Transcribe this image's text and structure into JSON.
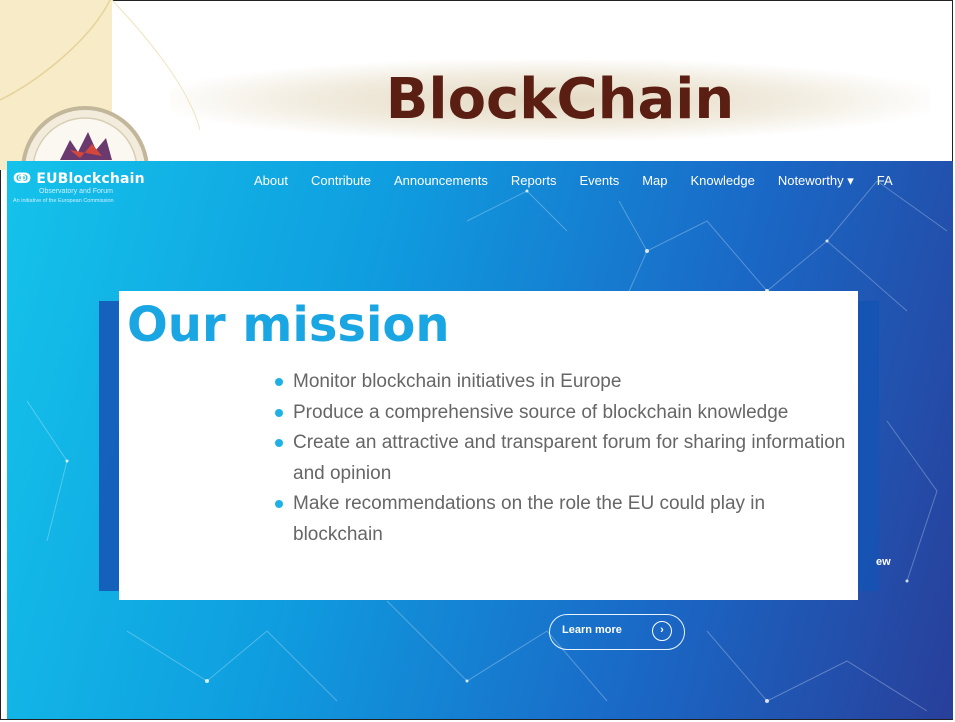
{
  "slide": {
    "title": "BlockChain"
  },
  "site": {
    "logo_text": "EUBlockchain",
    "logo_subtitle": "Observatory and Forum",
    "logo_tagline": "An initiative of the European Commission",
    "nav": [
      "About",
      "Contribute",
      "Announcements",
      "Reports",
      "Events",
      "Map",
      "Knowledge",
      "Noteworthy ▾",
      "FA"
    ],
    "partial_text": "ew",
    "learn_more": "Learn more",
    "learn_more_icon": "chevron-right-icon"
  },
  "mission": {
    "title": "Our mission",
    "items": [
      "Monitor blockchain initiatives in Europe",
      "Produce a comprehensive source of blockchain knowledge",
      "Create an attractive and transparent forum for sharing information and opinion",
      "Make recommendations on the role the EU could play in blockchain"
    ]
  },
  "colors": {
    "title": "#5a1f12",
    "mission_title": "#1aa6e3",
    "bg_start": "#14c3ea",
    "bg_end": "#283f9a"
  }
}
